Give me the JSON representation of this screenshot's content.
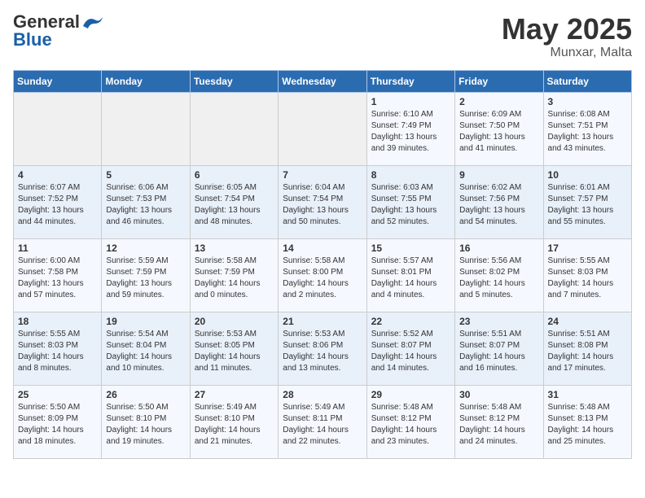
{
  "header": {
    "logo_general": "General",
    "logo_blue": "Blue",
    "month_year": "May 2025",
    "location": "Munxar, Malta"
  },
  "weekdays": [
    "Sunday",
    "Monday",
    "Tuesday",
    "Wednesday",
    "Thursday",
    "Friday",
    "Saturday"
  ],
  "weeks": [
    [
      {
        "day": "",
        "info": ""
      },
      {
        "day": "",
        "info": ""
      },
      {
        "day": "",
        "info": ""
      },
      {
        "day": "",
        "info": ""
      },
      {
        "day": "1",
        "info": "Sunrise: 6:10 AM\nSunset: 7:49 PM\nDaylight: 13 hours\nand 39 minutes."
      },
      {
        "day": "2",
        "info": "Sunrise: 6:09 AM\nSunset: 7:50 PM\nDaylight: 13 hours\nand 41 minutes."
      },
      {
        "day": "3",
        "info": "Sunrise: 6:08 AM\nSunset: 7:51 PM\nDaylight: 13 hours\nand 43 minutes."
      }
    ],
    [
      {
        "day": "4",
        "info": "Sunrise: 6:07 AM\nSunset: 7:52 PM\nDaylight: 13 hours\nand 44 minutes."
      },
      {
        "day": "5",
        "info": "Sunrise: 6:06 AM\nSunset: 7:53 PM\nDaylight: 13 hours\nand 46 minutes."
      },
      {
        "day": "6",
        "info": "Sunrise: 6:05 AM\nSunset: 7:54 PM\nDaylight: 13 hours\nand 48 minutes."
      },
      {
        "day": "7",
        "info": "Sunrise: 6:04 AM\nSunset: 7:54 PM\nDaylight: 13 hours\nand 50 minutes."
      },
      {
        "day": "8",
        "info": "Sunrise: 6:03 AM\nSunset: 7:55 PM\nDaylight: 13 hours\nand 52 minutes."
      },
      {
        "day": "9",
        "info": "Sunrise: 6:02 AM\nSunset: 7:56 PM\nDaylight: 13 hours\nand 54 minutes."
      },
      {
        "day": "10",
        "info": "Sunrise: 6:01 AM\nSunset: 7:57 PM\nDaylight: 13 hours\nand 55 minutes."
      }
    ],
    [
      {
        "day": "11",
        "info": "Sunrise: 6:00 AM\nSunset: 7:58 PM\nDaylight: 13 hours\nand 57 minutes."
      },
      {
        "day": "12",
        "info": "Sunrise: 5:59 AM\nSunset: 7:59 PM\nDaylight: 13 hours\nand 59 minutes."
      },
      {
        "day": "13",
        "info": "Sunrise: 5:58 AM\nSunset: 7:59 PM\nDaylight: 14 hours\nand 0 minutes."
      },
      {
        "day": "14",
        "info": "Sunrise: 5:58 AM\nSunset: 8:00 PM\nDaylight: 14 hours\nand 2 minutes."
      },
      {
        "day": "15",
        "info": "Sunrise: 5:57 AM\nSunset: 8:01 PM\nDaylight: 14 hours\nand 4 minutes."
      },
      {
        "day": "16",
        "info": "Sunrise: 5:56 AM\nSunset: 8:02 PM\nDaylight: 14 hours\nand 5 minutes."
      },
      {
        "day": "17",
        "info": "Sunrise: 5:55 AM\nSunset: 8:03 PM\nDaylight: 14 hours\nand 7 minutes."
      }
    ],
    [
      {
        "day": "18",
        "info": "Sunrise: 5:55 AM\nSunset: 8:03 PM\nDaylight: 14 hours\nand 8 minutes."
      },
      {
        "day": "19",
        "info": "Sunrise: 5:54 AM\nSunset: 8:04 PM\nDaylight: 14 hours\nand 10 minutes."
      },
      {
        "day": "20",
        "info": "Sunrise: 5:53 AM\nSunset: 8:05 PM\nDaylight: 14 hours\nand 11 minutes."
      },
      {
        "day": "21",
        "info": "Sunrise: 5:53 AM\nSunset: 8:06 PM\nDaylight: 14 hours\nand 13 minutes."
      },
      {
        "day": "22",
        "info": "Sunrise: 5:52 AM\nSunset: 8:07 PM\nDaylight: 14 hours\nand 14 minutes."
      },
      {
        "day": "23",
        "info": "Sunrise: 5:51 AM\nSunset: 8:07 PM\nDaylight: 14 hours\nand 16 minutes."
      },
      {
        "day": "24",
        "info": "Sunrise: 5:51 AM\nSunset: 8:08 PM\nDaylight: 14 hours\nand 17 minutes."
      }
    ],
    [
      {
        "day": "25",
        "info": "Sunrise: 5:50 AM\nSunset: 8:09 PM\nDaylight: 14 hours\nand 18 minutes."
      },
      {
        "day": "26",
        "info": "Sunrise: 5:50 AM\nSunset: 8:10 PM\nDaylight: 14 hours\nand 19 minutes."
      },
      {
        "day": "27",
        "info": "Sunrise: 5:49 AM\nSunset: 8:10 PM\nDaylight: 14 hours\nand 21 minutes."
      },
      {
        "day": "28",
        "info": "Sunrise: 5:49 AM\nSunset: 8:11 PM\nDaylight: 14 hours\nand 22 minutes."
      },
      {
        "day": "29",
        "info": "Sunrise: 5:48 AM\nSunset: 8:12 PM\nDaylight: 14 hours\nand 23 minutes."
      },
      {
        "day": "30",
        "info": "Sunrise: 5:48 AM\nSunset: 8:12 PM\nDaylight: 14 hours\nand 24 minutes."
      },
      {
        "day": "31",
        "info": "Sunrise: 5:48 AM\nSunset: 8:13 PM\nDaylight: 14 hours\nand 25 minutes."
      }
    ]
  ]
}
